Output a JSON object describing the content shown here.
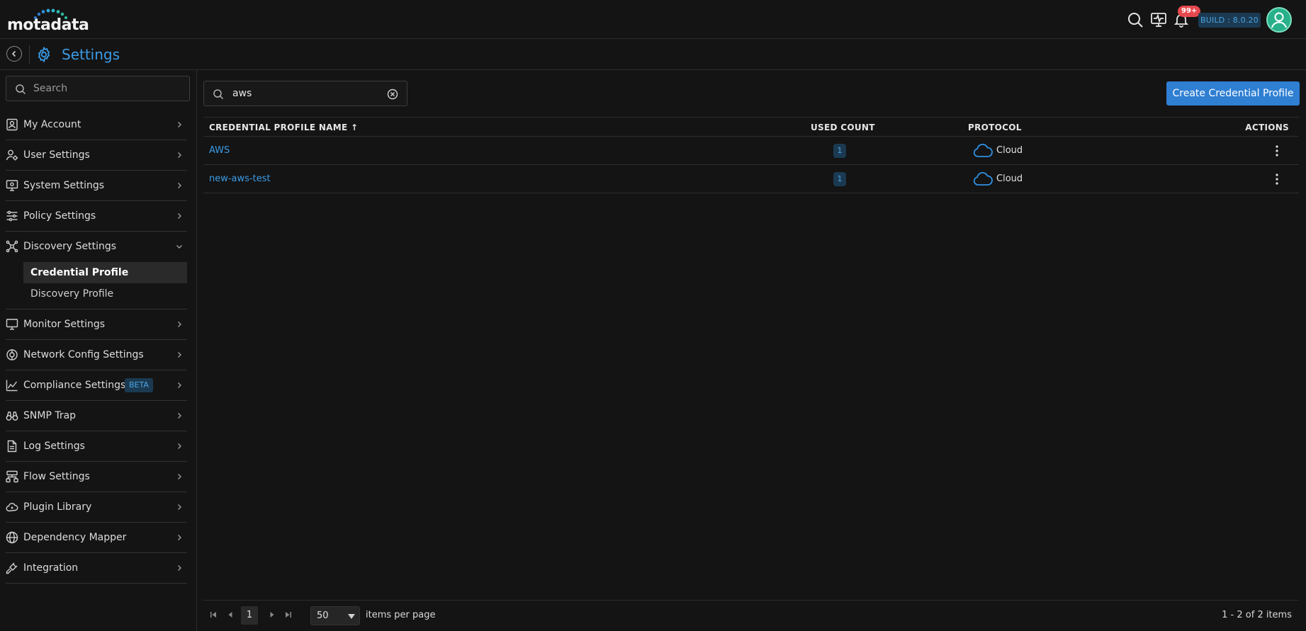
{
  "header": {
    "logo_text": "motadata",
    "notifications_badge": "99+",
    "build_label": "BUILD : 8.0.20",
    "icons": [
      "search-icon",
      "monitor-pulse-icon",
      "bell-icon",
      "user-avatar"
    ]
  },
  "breadcrumb": {
    "title": "Settings",
    "icon": "gear-icon"
  },
  "sidebar": {
    "search_placeholder": "Search",
    "items": [
      {
        "label": "My Account",
        "icon": "user-badge-icon"
      },
      {
        "label": "User Settings",
        "icon": "user-gear-icon"
      },
      {
        "label": "System Settings",
        "icon": "monitor-gear-icon"
      },
      {
        "label": "Policy Settings",
        "icon": "sliders-icon"
      },
      {
        "label": "Discovery Settings",
        "icon": "network-nodes-icon",
        "expanded": true,
        "children": [
          {
            "label": "Credential Profile",
            "active": true
          },
          {
            "label": "Discovery Profile",
            "active": false
          }
        ]
      },
      {
        "label": "Monitor Settings",
        "icon": "monitor-icon"
      },
      {
        "label": "Network Config Settings",
        "icon": "network-config-icon"
      },
      {
        "label": "Compliance Settings",
        "icon": "chart-line-icon",
        "badge": "BETA"
      },
      {
        "label": "SNMP Trap",
        "icon": "binoculars-icon"
      },
      {
        "label": "Log Settings",
        "icon": "file-text-icon"
      },
      {
        "label": "Flow Settings",
        "icon": "flow-icon"
      },
      {
        "label": "Plugin Library",
        "icon": "plugin-cloud-icon"
      },
      {
        "label": "Dependency Mapper",
        "icon": "globe-icon"
      },
      {
        "label": "Integration",
        "icon": "plug-icon"
      }
    ]
  },
  "main": {
    "filter_value": "aws",
    "create_button_label": "Create Credential Profile",
    "table": {
      "columns": {
        "name": "CREDENTIAL PROFILE NAME",
        "used": "USED COUNT",
        "protocol": "PROTOCOL",
        "actions": "ACTIONS"
      },
      "sort_indicator": "↑",
      "rows": [
        {
          "name": "AWS",
          "used_count": "1",
          "protocol": "Cloud"
        },
        {
          "name": "new-aws-test",
          "used_count": "1",
          "protocol": "Cloud"
        }
      ]
    },
    "pager": {
      "current_page": "1",
      "per_page": "50",
      "per_page_label": "items per page",
      "range_text": "1 - 2 of 2 items"
    }
  },
  "colors": {
    "accent": "#3b9be6",
    "button": "#2f7fd3",
    "background": "#141414",
    "badge_bg": "#1b3a52",
    "danger": "#e5484d"
  }
}
